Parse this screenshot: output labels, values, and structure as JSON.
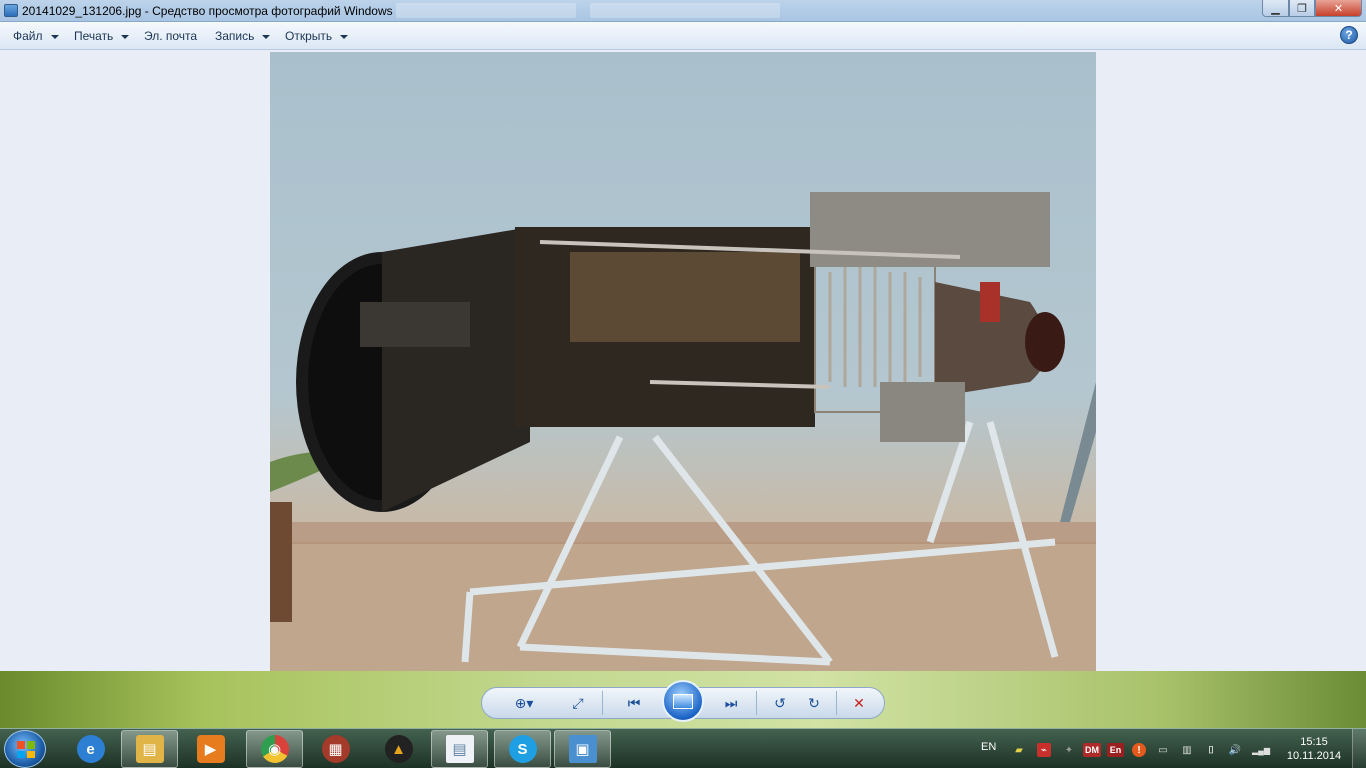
{
  "window": {
    "title": "20141029_131206.jpg - Средство просмотра фотографий Windows",
    "min_glyph": "▁",
    "max_glyph": "❐",
    "close_glyph": "✕"
  },
  "menu": {
    "items": [
      {
        "label": "Файл",
        "has_arrow": true
      },
      {
        "label": "Печать",
        "has_arrow": true
      },
      {
        "label": "Эл. почта",
        "has_arrow": false
      },
      {
        "label": "Запись",
        "has_arrow": true
      },
      {
        "label": "Открыть",
        "has_arrow": true
      }
    ],
    "help_glyph": "?"
  },
  "photo": {
    "subject": "turbine-engine-exhibit",
    "colors": {
      "wall": "#b1c5cf",
      "floor": "#c2ab93",
      "engine": "#2a2620",
      "stand": "#dfe6ea"
    }
  },
  "controls": {
    "zoom_glyph": "⊕▾",
    "fit_glyph": "⤢",
    "prev_glyph": "⏮",
    "next_glyph": "⏭",
    "rotate_ccw_glyph": "↺",
    "rotate_cw_glyph": "↻",
    "delete_glyph": "✕"
  },
  "taskbar": {
    "apps": [
      {
        "name": "ie",
        "glyph": "e",
        "color": "#2d7fd3"
      },
      {
        "name": "explorer",
        "glyph": "▤",
        "color": "#e0b446"
      },
      {
        "name": "media-player",
        "glyph": "▶",
        "color": "#e67c1d"
      },
      {
        "name": "chrome",
        "glyph": "◉",
        "color": "#d9423b"
      },
      {
        "name": "ppt-icon",
        "glyph": "▦",
        "color": "#a33a2a"
      },
      {
        "name": "nero",
        "glyph": "▲",
        "color": "#e9a51a"
      },
      {
        "name": "document",
        "glyph": "▤",
        "color": "#5e7fa3"
      },
      {
        "name": "skype",
        "glyph": "S",
        "color": "#1e9fe3"
      },
      {
        "name": "photo-viewer",
        "glyph": "▣",
        "color": "#4a8fcf"
      }
    ],
    "tray": {
      "lang": "EN",
      "icons": [
        {
          "name": "folder",
          "glyph": "▰",
          "color": "#e6d24a"
        },
        {
          "name": "pdf",
          "glyph": "⌁",
          "color": "#c9302c"
        },
        {
          "name": "plugin",
          "glyph": "✦",
          "color": "#7a7a7a"
        },
        {
          "name": "dm",
          "glyph": "DM",
          "color": "#b02a2a"
        },
        {
          "name": "en-flag",
          "glyph": "En",
          "color": "#9a2020"
        },
        {
          "name": "alert",
          "glyph": "!",
          "color": "#e25a1c"
        },
        {
          "name": "device",
          "glyph": "▭",
          "color": "#6b6b6b"
        },
        {
          "name": "network-box",
          "glyph": "▥",
          "color": "#6b6b6b"
        },
        {
          "name": "usb",
          "glyph": "⌷",
          "color": "#6b6b6b"
        },
        {
          "name": "volume",
          "glyph": "🔊",
          "color": "transparent"
        },
        {
          "name": "signal",
          "glyph": "▂▄▆",
          "color": "transparent"
        }
      ],
      "time": "15:15",
      "date": "10.11.2014"
    }
  }
}
